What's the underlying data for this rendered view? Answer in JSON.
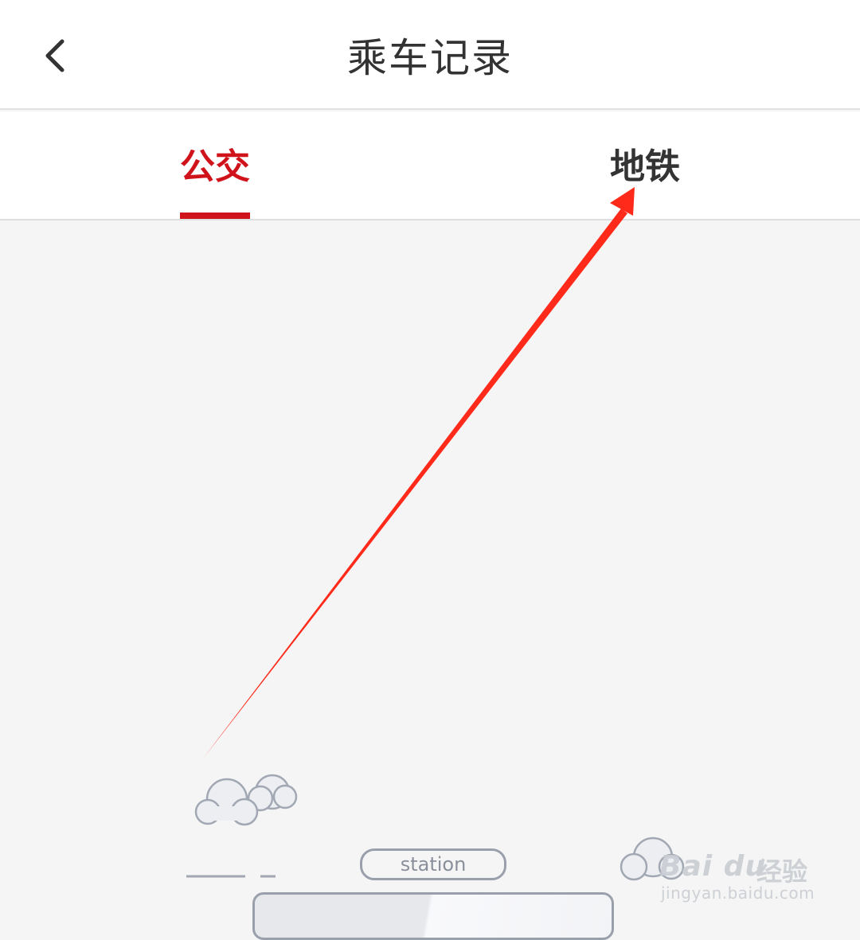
{
  "header": {
    "back_icon": "chevron-left-icon",
    "title": "乘车记录"
  },
  "tabs": [
    {
      "label": "公交",
      "active": true
    },
    {
      "label": "地铁",
      "active": false
    }
  ],
  "illustration": {
    "station_label": "station"
  },
  "watermark": {
    "logo": "Bai du",
    "product": "经验",
    "url": "jingyan.baidu.com"
  },
  "colors": {
    "accent": "#d0121b",
    "arrow": "#ff2a1a",
    "title_text": "#333333",
    "background": "#f5f5f5"
  }
}
